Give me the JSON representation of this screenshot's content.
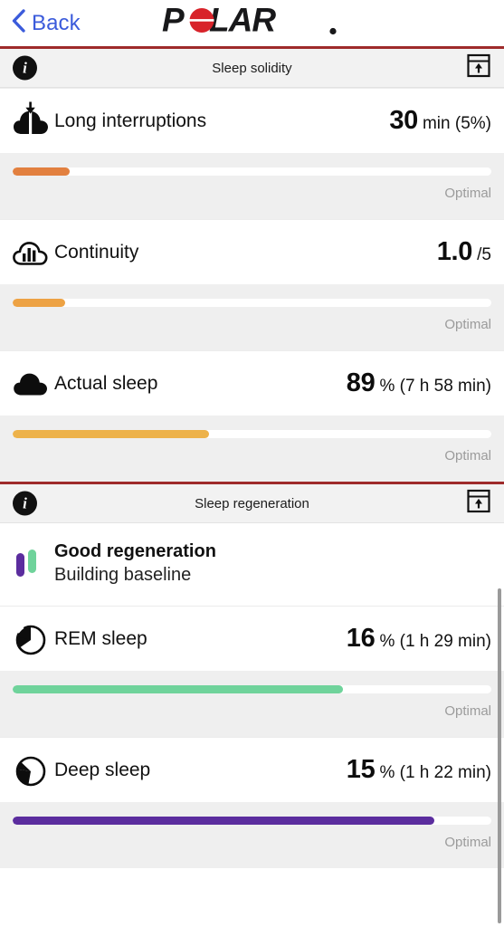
{
  "nav": {
    "back_label": "Back",
    "brand": "POLAR",
    "brand_registered": "®",
    "back_color": "#3b5bdb",
    "brand_accent": "#d8232a"
  },
  "accent_rule_color": "#9e2b2b",
  "sections": [
    {
      "title": "Sleep solidity",
      "info_icon": "info-icon",
      "panel_icon": "collapse-panel-icon",
      "metrics": [
        {
          "icon": "cloud-split-arrow-icon",
          "label": "Long interruptions",
          "value": "30",
          "unit": "min (5%)",
          "bar_percent": 12,
          "bar_color": "#e2803f",
          "caption": "Optimal"
        },
        {
          "icon": "cloud-bars-icon",
          "label": "Continuity",
          "value": "1.0",
          "unit": "/5",
          "bar_percent": 11,
          "bar_color": "#eda244",
          "caption": "Optimal"
        },
        {
          "icon": "cloud-filled-icon",
          "label": "Actual sleep",
          "value": "89",
          "unit": "% (7 h 58 min)",
          "bar_percent": 41,
          "bar_color": "#edb24a",
          "caption": "Optimal"
        }
      ]
    },
    {
      "title": "Sleep regeneration",
      "info_icon": "info-icon",
      "panel_icon": "collapse-panel-icon",
      "summary": {
        "icon": "two-bars-icon",
        "title": "Good regeneration",
        "subtitle": "Building baseline",
        "bar_left_color": "#5b2d9e",
        "bar_right_color": "#6fd39b"
      },
      "metrics": [
        {
          "icon": "rem-sleep-pie-icon",
          "label": "REM sleep",
          "value": "16",
          "unit": "% (1 h 29 min)",
          "bar_percent": 69,
          "bar_color": "#6fd39b",
          "caption": "Optimal"
        },
        {
          "icon": "deep-sleep-pie-icon",
          "label": "Deep sleep",
          "value": "15",
          "unit": "% (1 h 22 min)",
          "bar_percent": 88,
          "bar_color": "#5b2d9e",
          "caption": "Optimal"
        }
      ]
    }
  ]
}
